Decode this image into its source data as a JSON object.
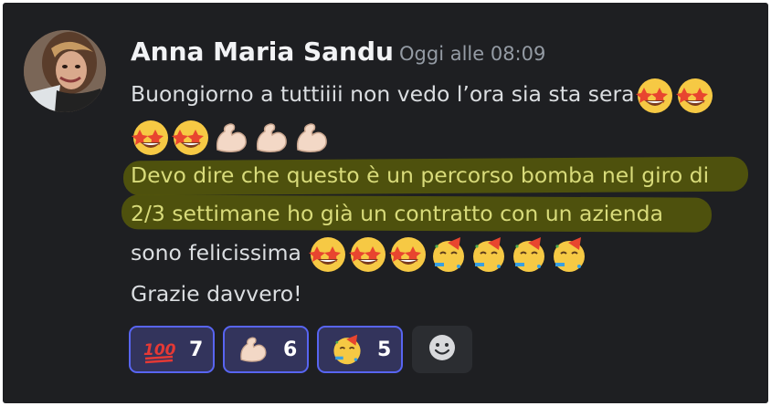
{
  "message": {
    "author": "Anna Maria Sandu",
    "timestamp": "Oggi alle 08:09",
    "line1": "Buongiorno a tuttiiii non vedo l’ora sia sta sera",
    "line3": "Devo dire che questo è un percorso bomba nel giro di",
    "line4": "2/3 settimane ho già un contratto con un azienda",
    "line5": "sono felicissima",
    "line6": "Grazie davvero!",
    "emojis_line1": [
      "star-struck",
      "star-struck"
    ],
    "emojis_line2": [
      "star-struck",
      "star-struck",
      "flexed-biceps",
      "flexed-biceps",
      "flexed-biceps"
    ],
    "emojis_line5": [
      "star-struck",
      "star-struck",
      "star-struck",
      "partying-face",
      "partying-face",
      "partying-face",
      "partying-face"
    ]
  },
  "reactions": [
    {
      "emoji": "hundred-points",
      "count": "7"
    },
    {
      "emoji": "flexed-biceps",
      "count": "6"
    },
    {
      "emoji": "partying-face",
      "count": "5"
    }
  ],
  "add_reaction": {
    "icon": "smiley-add-icon"
  },
  "colors": {
    "background": "#1e1f22",
    "text": "#dbdee1",
    "author": "#f2f3f5",
    "timestamp": "#949ba4",
    "reaction_bg": "#33345c",
    "reaction_border": "#5865f2",
    "highlight": "#51540d"
  }
}
